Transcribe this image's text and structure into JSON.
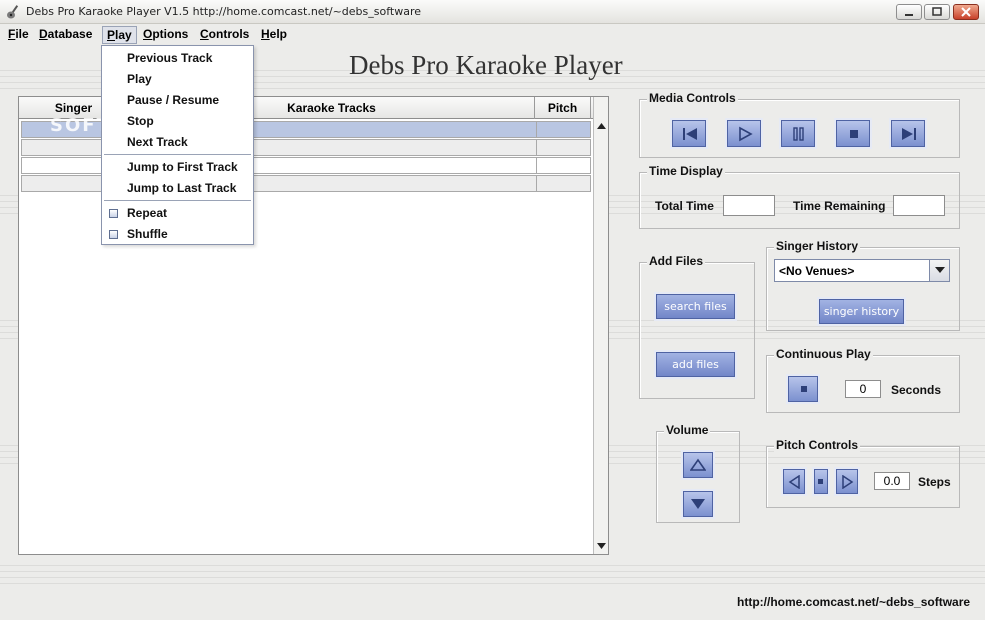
{
  "window": {
    "title": "Debs Pro Karaoke Player  V1.5  http://home.comcast.net/~debs_software",
    "controls": [
      "minimize-icon",
      "maximize-icon",
      "close-icon"
    ]
  },
  "menubar": {
    "items": [
      {
        "label": "File",
        "mnemonic": "F",
        "rest": "ile"
      },
      {
        "label": "Database",
        "mnemonic": "D",
        "rest": "atabase"
      },
      {
        "label": "Play",
        "mnemonic": "P",
        "rest": "lay"
      },
      {
        "label": "Options",
        "mnemonic": "O",
        "rest": "ptions"
      },
      {
        "label": "Controls",
        "mnemonic": "C",
        "rest": "ontrols"
      },
      {
        "label": "Help",
        "mnemonic": "H",
        "rest": "elp"
      }
    ]
  },
  "play_menu": {
    "items": [
      "Previous Track",
      "Play",
      "Pause / Resume",
      "Stop",
      "Next Track"
    ],
    "jump_items": [
      "Jump to First Track",
      "Jump to Last Track"
    ],
    "toggle_items": [
      "Repeat",
      "Shuffle"
    ]
  },
  "heading": "Debs Pro Karaoke Player",
  "watermark": "SOFTPEDIA",
  "track_table": {
    "columns": [
      "Singer",
      "Karaoke Tracks",
      "Pitch"
    ]
  },
  "media_controls": {
    "title": "Media Controls",
    "buttons": [
      "previous-icon",
      "play-icon",
      "pause-icon",
      "stop-icon",
      "next-icon"
    ]
  },
  "time_display": {
    "title": "Time Display",
    "total_label": "Total Time",
    "total_value": "",
    "remaining_label": "Time Remaining",
    "remaining_value": ""
  },
  "add_files": {
    "title": "Add Files",
    "search_label": "search files",
    "add_label": "add  files"
  },
  "singer_history": {
    "title": "Singer History",
    "selected": "<No Venues>",
    "button_label": "singer history"
  },
  "continuous_play": {
    "title": "Continuous Play",
    "value": "0",
    "unit": "Seconds"
  },
  "volume": {
    "title": "Volume"
  },
  "pitch_controls": {
    "title": "Pitch Controls",
    "value": "0.0",
    "unit": "Steps"
  },
  "footer_url": "http://home.comcast.net/~debs_software",
  "colors": {
    "button_blue": "#7b90cf",
    "selected_row": "#b9c6e2",
    "background": "#ececea"
  }
}
